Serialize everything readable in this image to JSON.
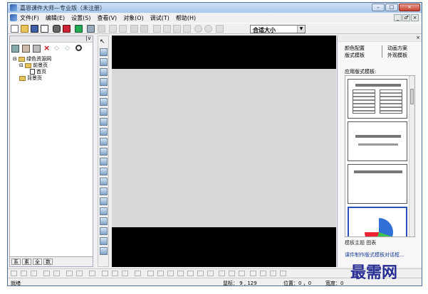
{
  "window": {
    "title": "嘉恩课件大师—专业版（未注册）",
    "controls": {
      "minimize": "–",
      "maximize": "□",
      "close": "×"
    }
  },
  "menu": {
    "items": [
      "文件(F)",
      "编辑(E)",
      "设置(S)",
      "查看(V)",
      "对象(O)",
      "调试(T)",
      "帮助(H)"
    ],
    "mdi_controls": [
      "_",
      "♂",
      "×"
    ]
  },
  "toolbar": {
    "zoom_value": "合适大小",
    "zoom_arrow": "▼"
  },
  "left_panel": {
    "pin": "|∨",
    "tree": [
      {
        "label": "绿色资源网",
        "level": 0,
        "expander": "⊟"
      },
      {
        "label": "前景页",
        "level": 1,
        "expander": "⊟"
      },
      {
        "label": "首页",
        "level": 2,
        "expander": ""
      },
      {
        "label": "背景页",
        "level": 1,
        "expander": ""
      }
    ],
    "tabs": [
      "系",
      "素",
      "全",
      "数"
    ]
  },
  "right_panel": {
    "close": "×",
    "tabs": {
      "color_config": "颜色配置",
      "animation_scheme": "动画方案",
      "layout_template": "版式模板",
      "appearance_template": "外观模板"
    },
    "apply_label": "应用版式模板:",
    "footer": "模板主题  图表",
    "link": "课件制作版式模板对话框..."
  },
  "status": {
    "ready": "就绪",
    "mouse": "鼠标：  9 ,  129",
    "position": "位置：0 ，0",
    "width": "宽度：0"
  },
  "watermark": "最需网",
  "colors": {
    "accent": "#2b4fb9",
    "stage": "#000000",
    "slide": "#d7d7d7",
    "watermark": "#262d93"
  }
}
